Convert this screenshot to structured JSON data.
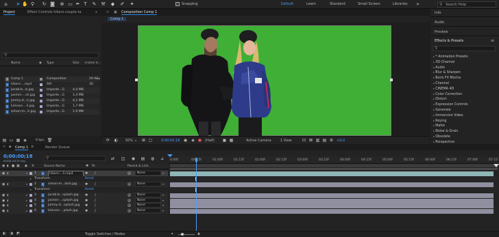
{
  "toolbar": {
    "snapping_label": "Snapping",
    "workspaces": [
      "Default",
      "Learn",
      "Standard",
      "Small Screen",
      "Libraries"
    ],
    "active_workspace": "Default",
    "search_placeholder": "Search Help"
  },
  "project_panel": {
    "tab_project": "Project",
    "tab_effect_controls": "Effect Controls hikers-couple-ta",
    "search_placeholder": "",
    "columns": {
      "name": "Name",
      "type": "Type",
      "size": "Size",
      "frame_rate": "Frame R..."
    },
    "items": [
      {
        "name": "Comp 1",
        "type": "Composition",
        "size": "",
        "frame_rate": "29.97",
        "color": "#8e8e8e",
        "kind": "comp"
      },
      {
        "name": "hikers-...mp4",
        "type": "AVI",
        "size": "",
        "frame_rate": "30",
        "color": "#a7b4c8",
        "kind": "file"
      },
      {
        "name": "jacob-b...b.jpg",
        "type": "Importe...G",
        "size": "4,4 MB",
        "frame_rate": "",
        "color": "#a8a1c9",
        "kind": "file"
      },
      {
        "name": "jasmin-...sh.jpg",
        "type": "Importe...G",
        "size": "1,4 MB",
        "frame_rate": "",
        "color": "#a8a1c9",
        "kind": "file"
      },
      {
        "name": "jimmy-d...h.jpg",
        "type": "Importe...G",
        "size": "4,1 MB",
        "frame_rate": "",
        "color": "#a8a1c9",
        "kind": "file"
      },
      {
        "name": "kimson-...h.jpg",
        "type": "Importe...G",
        "size": "1,7 MB",
        "frame_rate": "",
        "color": "#a8a1c9",
        "kind": "file"
      },
      {
        "name": "simon-m...h.jpg",
        "type": "Importe...G",
        "size": "1,9 MB",
        "frame_rate": "",
        "color": "#a8a1c9",
        "kind": "file"
      }
    ],
    "bpc_label": "8 bpc"
  },
  "composition_panel": {
    "tab_label": "Composition Comp 1",
    "breadcrumb": "Comp 1",
    "zoom": "50%",
    "timecode": "0;00;00;18",
    "resolution": "(Half)",
    "camera": "Active Camera",
    "views": "1 View",
    "exposure": "+0,0"
  },
  "right_panel": {
    "sections": [
      "Info",
      "Audio",
      "Preview",
      "Effects & Presets"
    ],
    "effects_search_placeholder": "",
    "effects": [
      "* Animation Presets",
      "3D Channel",
      "Audio",
      "Blur & Sharpen",
      "Boris FX Mocha",
      "Channel",
      "CINEMA 4D",
      "Color Correction",
      "Distort",
      "Expression Controls",
      "Generate",
      "Immersive Video",
      "Keying",
      "Matte",
      "Noise & Grain",
      "Obsolete",
      "Perspective"
    ]
  },
  "timeline": {
    "tab_comp": "Comp 1",
    "tab_render_queue": "Render Queue",
    "timecode": "0;00;00;18",
    "frame_info": "00018 (29.97 fps)",
    "col_source_name": "Source Name",
    "col_parent": "Parent & Link",
    "ruler_labels": [
      "0:00f",
      "00:15f",
      "01:00f",
      "01:15f",
      "02:00f",
      "02:15f",
      "03:00f",
      "03:15f",
      "04:00f",
      "04:15f",
      "05:00f",
      "05:15f",
      "06:00f",
      "06:15f",
      "07:00f",
      "07:15"
    ],
    "playhead_time": "00:18f",
    "layers": [
      {
        "num": "1",
        "name": "hikers-...h.mp4",
        "parent": "None",
        "color": "#a7b4c8",
        "selected": true
      },
      {
        "transform": "Transform",
        "reset": "Reset"
      },
      {
        "num": "2",
        "name": "simon-m...lash.jpg",
        "parent": "None",
        "color": "#a8a1c9",
        "selected": false
      },
      {
        "transform": "Transform",
        "reset": "Reset"
      },
      {
        "num": "3",
        "name": "jacob-b...splash.jpg",
        "parent": "None",
        "color": "#a8a1c9",
        "selected": false
      },
      {
        "num": "4",
        "name": "jasmin-...splash.jpg",
        "parent": "None",
        "color": "#a8a1c9",
        "selected": false
      },
      {
        "num": "5",
        "name": "jimmy-d...splash.jpg",
        "parent": "None",
        "color": "#a8a1c9",
        "selected": false
      },
      {
        "num": "6",
        "name": "kimson-...plash.jpg",
        "parent": "None",
        "color": "#a8a1c9",
        "selected": false
      }
    ],
    "footer_label": "Toggle Switches / Modes"
  },
  "colors": {
    "accent": "#2d8ceb",
    "green_screen": "#3faf35",
    "bar_video": "#8fb6b7",
    "bar_image": "#8f8f9f"
  }
}
